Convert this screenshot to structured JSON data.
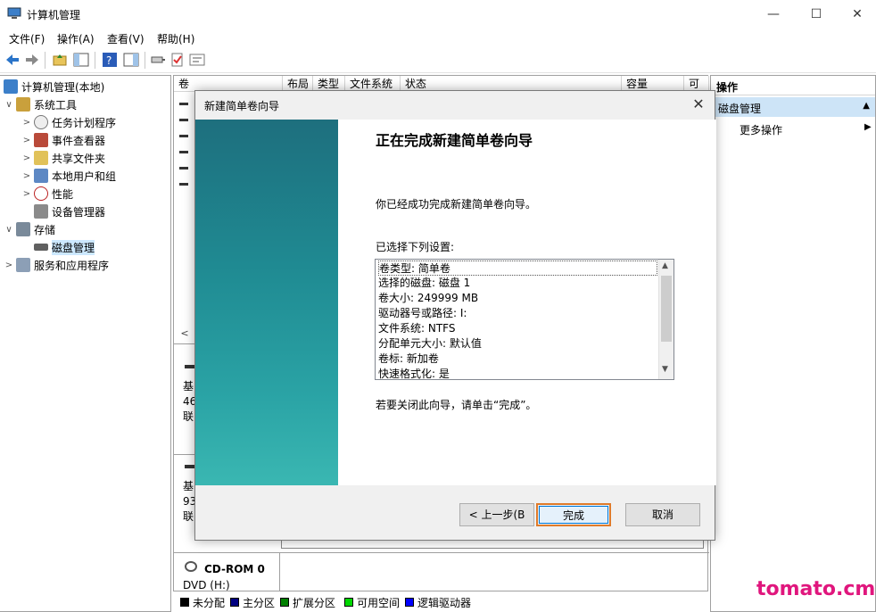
{
  "window": {
    "title": "计算机管理",
    "min": "—",
    "max": "☐",
    "close": "✕"
  },
  "menu": [
    "文件(F)",
    "操作(A)",
    "查看(V)",
    "帮助(H)"
  ],
  "tree": [
    {
      "label": "计算机管理(本地)",
      "level": 0,
      "arrow": ""
    },
    {
      "label": "系统工具",
      "level": 1,
      "arrow": "∨"
    },
    {
      "label": "任务计划程序",
      "level": 2,
      "arrow": ">"
    },
    {
      "label": "事件查看器",
      "level": 2,
      "arrow": ">"
    },
    {
      "label": "共享文件夹",
      "level": 2,
      "arrow": ">"
    },
    {
      "label": "本地用户和组",
      "level": 2,
      "arrow": ">"
    },
    {
      "label": "性能",
      "level": 2,
      "arrow": ">"
    },
    {
      "label": "设备管理器",
      "level": 2,
      "arrow": ""
    },
    {
      "label": "存储",
      "level": 1,
      "arrow": "∨"
    },
    {
      "label": "磁盘管理",
      "level": 2,
      "arrow": ""
    },
    {
      "label": "服务和应用程序",
      "level": 1,
      "arrow": ">"
    }
  ],
  "columns": [
    "卷",
    "布局",
    "类型",
    "文件系统",
    "状态",
    "容量",
    "可"
  ],
  "disk_panels": [
    {
      "line1": "基",
      "line2": "46",
      "line3": "联"
    },
    {
      "line1": "基",
      "line2": "93",
      "line3": "联"
    }
  ],
  "cdrom": {
    "name": "CD-ROM 0",
    "drive": "DVD (H:)"
  },
  "legend": [
    {
      "label": "未分配",
      "color": "#000000"
    },
    {
      "label": "主分区",
      "color": "#000080"
    },
    {
      "label": "扩展分区",
      "color": "#008000"
    },
    {
      "label": "可用空间",
      "color": "#00d800"
    },
    {
      "label": "逻辑驱动器",
      "color": "#0000ff"
    }
  ],
  "actions": {
    "header": "操作",
    "section": "磁盘管理",
    "more": "更多操作"
  },
  "dialog": {
    "title": "新建简单卷向导",
    "heading": "正在完成新建简单卷向导",
    "desc": "你已经成功完成新建简单卷向导。",
    "settings_label": "已选择下列设置:",
    "settings": [
      "卷类型: 简单卷",
      "选择的磁盘: 磁盘 1",
      "卷大小: 249999 MB",
      "驱动器号或路径: I:",
      "文件系统: NTFS",
      "分配单元大小: 默认值",
      "卷标: 新加卷",
      "快速格式化: 是"
    ],
    "hint": "若要关闭此向导，请单击“完成”。",
    "back": "< 上一步(B",
    "finish": "完成",
    "cancel": "取消"
  },
  "watermark": "tomato.cm"
}
